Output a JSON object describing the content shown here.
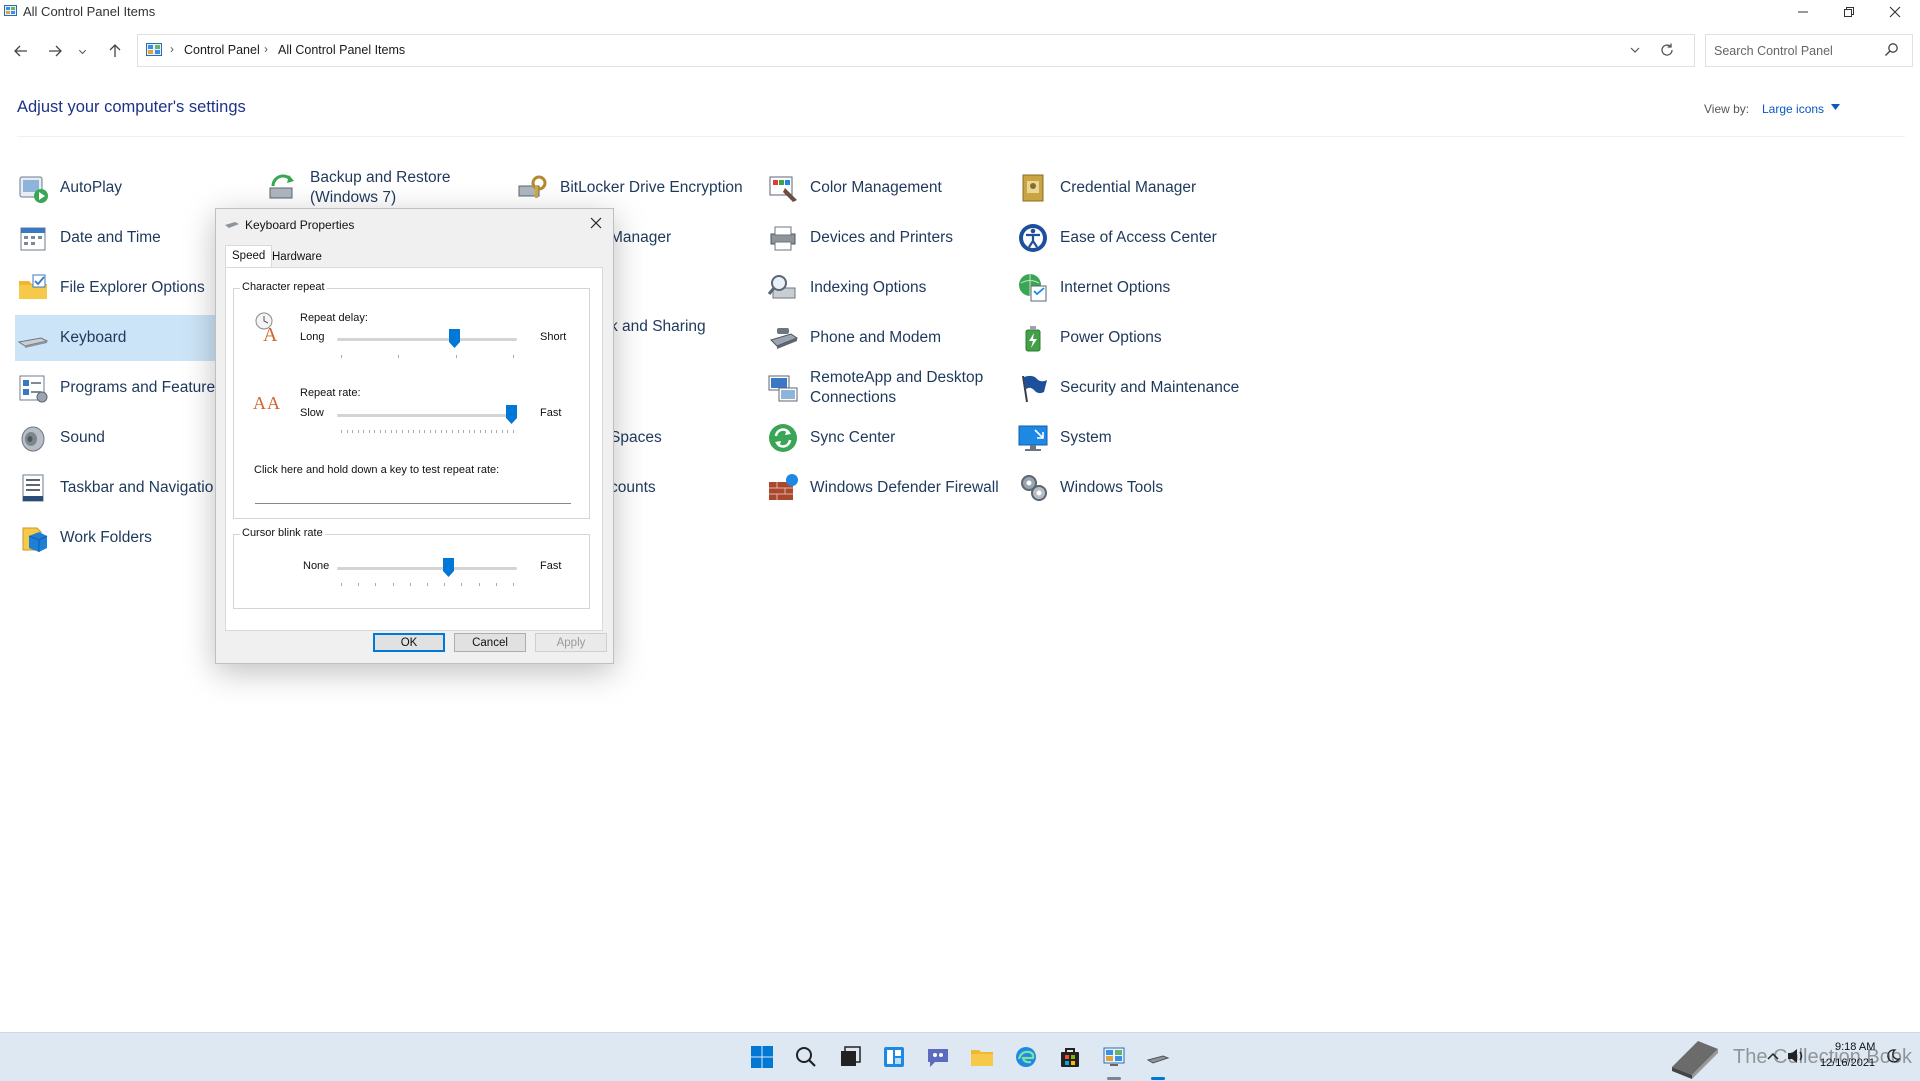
{
  "window": {
    "title": "All Control Panel Items"
  },
  "address": {
    "crumbs": [
      "Control Panel",
      "All Control Panel Items"
    ],
    "separator": "›"
  },
  "search": {
    "placeholder": "Search Control Panel"
  },
  "header": {
    "title": "Adjust your computer's settings",
    "view_by_label": "View by:",
    "view_by_value": "Large icons"
  },
  "items": [
    {
      "label": "AutoPlay",
      "icon": "autoplay-icon"
    },
    {
      "label": "Backup and Restore (Windows 7)",
      "icon": "backup-restore-icon"
    },
    {
      "label": "BitLocker Drive Encryption",
      "icon": "bitlocker-icon"
    },
    {
      "label": "Color Management",
      "icon": "color-management-icon"
    },
    {
      "label": "Credential Manager",
      "icon": "credential-manager-icon"
    },
    {
      "label": "Date and Time",
      "icon": "date-time-icon"
    },
    {
      "label": "Manager",
      "icon": "device-manager-icon"
    },
    {
      "label": "Devices and Printers",
      "icon": "devices-printers-icon"
    },
    {
      "label": "Ease of Access Center",
      "icon": "ease-of-access-icon"
    },
    {
      "label": "File Explorer Options",
      "icon": "folder-options-icon"
    },
    {
      "label": "Indexing Options",
      "icon": "indexing-icon"
    },
    {
      "label": "Internet Options",
      "icon": "internet-options-icon"
    },
    {
      "label": "Keyboard",
      "icon": "keyboard-icon"
    },
    {
      "label": "k and Sharing",
      "icon": "network-sharing-icon"
    },
    {
      "label": "Phone and Modem",
      "icon": "phone-modem-icon"
    },
    {
      "label": "Power Options",
      "icon": "power-options-icon"
    },
    {
      "label": "Programs and Feature",
      "icon": "programs-features-icon"
    },
    {
      "label": "RemoteApp and Desktop Connections",
      "icon": "remoteapp-icon"
    },
    {
      "label": "Security and Maintenance",
      "icon": "security-flag-icon"
    },
    {
      "label": "Sound",
      "icon": "sound-icon"
    },
    {
      "label": "Spaces",
      "icon": "storage-spaces-icon"
    },
    {
      "label": "Sync Center",
      "icon": "sync-center-icon"
    },
    {
      "label": "System",
      "icon": "system-icon"
    },
    {
      "label": "Taskbar and Navigatio",
      "icon": "taskbar-icon"
    },
    {
      "label": "counts",
      "icon": "user-accounts-icon"
    },
    {
      "label": "Windows Defender Firewall",
      "icon": "firewall-icon"
    },
    {
      "label": "Windows Tools",
      "icon": "windows-tools-icon"
    },
    {
      "label": "Work Folders",
      "icon": "work-folders-icon"
    }
  ],
  "dialog": {
    "title": "Keyboard Properties",
    "tabs": [
      "Speed",
      "Hardware"
    ],
    "character_repeat": {
      "group_title": "Character repeat",
      "repeat_delay_label": "Repeat delay:",
      "delay_left": "Long",
      "delay_right": "Short",
      "delay_level": 0.66,
      "repeat_rate_label": "Repeat rate:",
      "rate_left": "Slow",
      "rate_right": "Fast",
      "rate_level": 1.0,
      "test_label": "Click here and hold down a key to test repeat rate:",
      "test_value": ""
    },
    "cursor_blink": {
      "group_title": "Cursor blink rate",
      "left": "None",
      "right": "Fast",
      "level": 0.63
    },
    "buttons": {
      "ok": "OK",
      "cancel": "Cancel",
      "apply": "Apply"
    }
  },
  "taskbar": {
    "time": "9:18 AM",
    "date": "12/16/2021",
    "watermark": "The Collection Book"
  },
  "colors": {
    "accent": "#0078d7",
    "link": "#1e395b",
    "header_blue": "#1e3287",
    "selection": "#cce4f7",
    "taskbar": "#dde8f3"
  }
}
